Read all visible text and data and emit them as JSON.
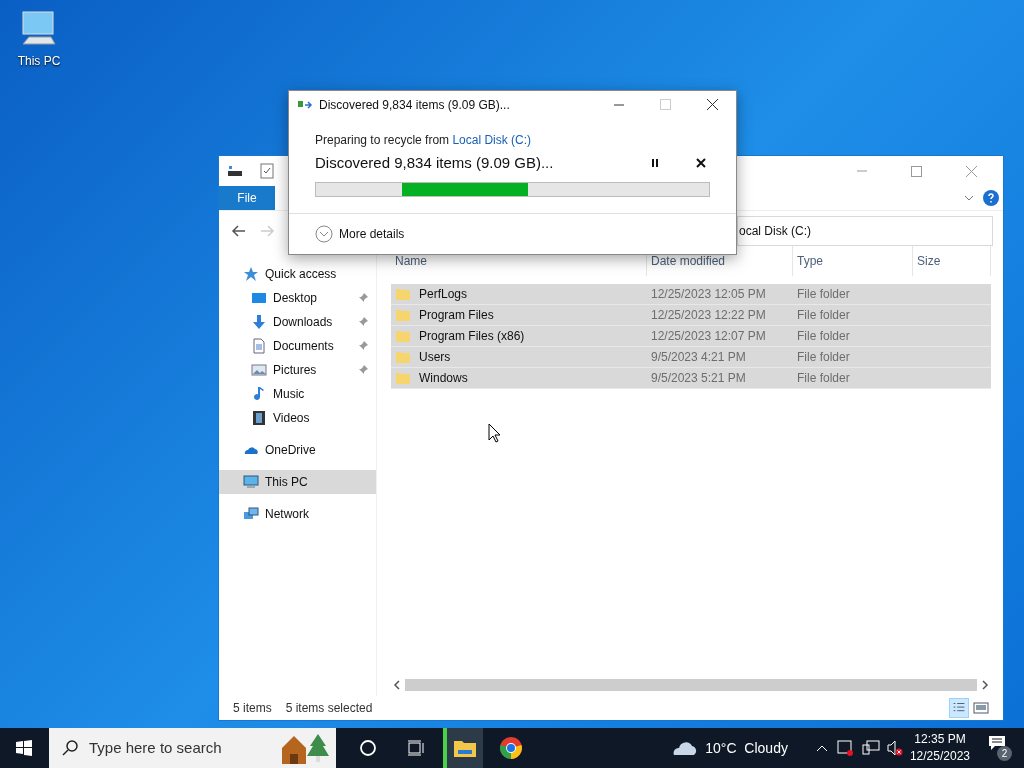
{
  "desktop_icons": [
    {
      "label": "This PC"
    }
  ],
  "explorer": {
    "ribbon_tab": "File",
    "address": "ocal Disk (C:)",
    "nav": [
      {
        "label": "Quick access",
        "kind": "star",
        "selected": false,
        "children": [
          {
            "label": "Desktop",
            "kind": "desktop",
            "pinned": true,
            "selected": false
          },
          {
            "label": "Downloads",
            "kind": "download",
            "pinned": true,
            "selected": false
          },
          {
            "label": "Documents",
            "kind": "document",
            "pinned": true,
            "selected": false
          },
          {
            "label": "Pictures",
            "kind": "picture",
            "pinned": true,
            "selected": false
          },
          {
            "label": "Music",
            "kind": "music",
            "pinned": false,
            "selected": false
          },
          {
            "label": "Videos",
            "kind": "video",
            "pinned": false,
            "selected": false
          }
        ]
      },
      {
        "label": "OneDrive",
        "kind": "cloud",
        "selected": false
      },
      {
        "label": "This PC",
        "kind": "pc",
        "selected": true
      },
      {
        "label": "Network",
        "kind": "network",
        "selected": false
      }
    ],
    "columns": [
      "Name",
      "Date modified",
      "Type",
      "Size"
    ],
    "rows": [
      {
        "name": "PerfLogs",
        "date": "12/25/2023 12:05 PM",
        "type": "File folder",
        "selected": true
      },
      {
        "name": "Program Files",
        "date": "12/25/2023 12:22 PM",
        "type": "File folder",
        "selected": true
      },
      {
        "name": "Program Files (x86)",
        "date": "12/25/2023 12:07 PM",
        "type": "File folder",
        "selected": true
      },
      {
        "name": "Users",
        "date": "9/5/2023 4:21 PM",
        "type": "File folder",
        "selected": true
      },
      {
        "name": "Windows",
        "date": "9/5/2023 5:21 PM",
        "type": "File folder",
        "selected": true
      }
    ],
    "status": {
      "count": "5 items",
      "selection": "5 items selected"
    }
  },
  "dialog": {
    "title": "Discovered 9,834 items (9.09 GB)...",
    "prefix": "Preparing to recycle from ",
    "source": "Local Disk (C:)",
    "heading": "Discovered 9,834 items (9.09 GB)...",
    "details": "More details"
  },
  "taskbar": {
    "search_placeholder": "Type here to search",
    "weather": "10°C  Cloudy",
    "time": "12:35 PM",
    "date": "12/25/2023",
    "notifications": "2"
  }
}
